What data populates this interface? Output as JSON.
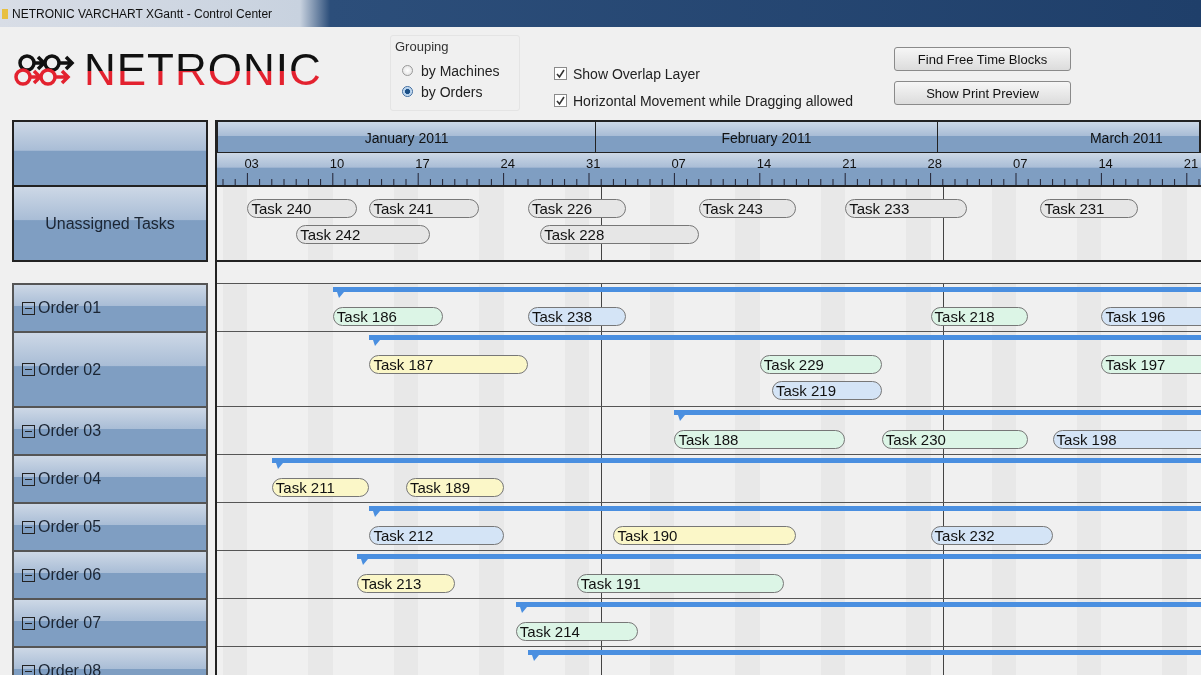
{
  "window": {
    "title": "NETRONIC VARCHART XGantt - Control Center"
  },
  "logo": {
    "text": "NETRONIC"
  },
  "grouping": {
    "label": "Grouping",
    "options": [
      {
        "label": "by Machines",
        "selected": false
      },
      {
        "label": "by Orders",
        "selected": true
      }
    ]
  },
  "options": [
    {
      "label": "Show Overlap Layer",
      "checked": true
    },
    {
      "label": "Horizontal Movement while Dragging allowed",
      "checked": true
    }
  ],
  "buttons": [
    "Find Free Time Blocks",
    "Show Print Preview"
  ],
  "timeline": {
    "months": [
      "January 2011",
      "February 2011",
      "March 2011"
    ],
    "weeks": [
      "03",
      "10",
      "17",
      "24",
      "31",
      "07",
      "14",
      "21",
      "28",
      "07",
      "14",
      "21"
    ]
  },
  "unassigned": {
    "label": "Unassigned Tasks",
    "lanes": [
      [
        {
          "label": "Task 240",
          "color": "#e6e6e6"
        },
        {
          "label": "Task 241",
          "color": "#e6e6e6"
        },
        {
          "label": "Task 226",
          "color": "#e6e6e6"
        },
        {
          "label": "Task 243",
          "color": "#e6e6e6"
        },
        {
          "label": "Task 233",
          "color": "#e6e6e6"
        },
        {
          "label": "Task 231",
          "color": "#e6e6e6"
        }
      ],
      [
        {
          "label": "Task 242",
          "color": "#e6e6e6"
        },
        {
          "label": "Task 228",
          "color": "#e6e6e6"
        }
      ]
    ]
  },
  "orders": [
    {
      "label": "Order 01",
      "expanded": true,
      "lanes": [
        [
          {
            "label": "Task 186",
            "color": "#dcf5e6"
          },
          {
            "label": "Task 238",
            "color": "#d4e4f6"
          },
          {
            "label": "Task 218",
            "color": "#dcf5e6"
          },
          {
            "label": "Task 196",
            "color": "#d4e4f6"
          }
        ]
      ]
    },
    {
      "label": "Order 02",
      "expanded": true,
      "lanes": [
        [
          {
            "label": "Task 187",
            "color": "#fbf7c8"
          },
          {
            "label": "Task 229",
            "color": "#dcf5e6"
          },
          {
            "label": "Task 197",
            "color": "#dcf5e6"
          }
        ],
        [
          {
            "label": "Task 219",
            "color": "#d4e4f6"
          }
        ]
      ]
    },
    {
      "label": "Order 03",
      "expanded": true,
      "lanes": [
        [
          {
            "label": "Task 188",
            "color": "#dcf5e6"
          },
          {
            "label": "Task 230",
            "color": "#dcf5e6"
          },
          {
            "label": "Task 198",
            "color": "#d4e4f6"
          }
        ]
      ]
    },
    {
      "label": "Order 04",
      "expanded": true,
      "lanes": [
        [
          {
            "label": "Task 211",
            "color": "#fbf7c8"
          },
          {
            "label": "Task 189",
            "color": "#fbf7c8"
          }
        ]
      ]
    },
    {
      "label": "Order 05",
      "expanded": true,
      "lanes": [
        [
          {
            "label": "Task 212",
            "color": "#d4e4f6"
          },
          {
            "label": "Task 190",
            "color": "#fbf7c8"
          },
          {
            "label": "Task 232",
            "color": "#d4e4f6"
          }
        ]
      ]
    },
    {
      "label": "Order 06",
      "expanded": true,
      "lanes": [
        [
          {
            "label": "Task 213",
            "color": "#fbf7c8"
          },
          {
            "label": "Task 191",
            "color": "#dcf5e6"
          }
        ]
      ]
    },
    {
      "label": "Order 07",
      "expanded": true,
      "lanes": [
        [
          {
            "label": "Task 214",
            "color": "#dcf5e6"
          }
        ]
      ]
    },
    {
      "label": "Order 08",
      "expanded": true
    }
  ]
}
